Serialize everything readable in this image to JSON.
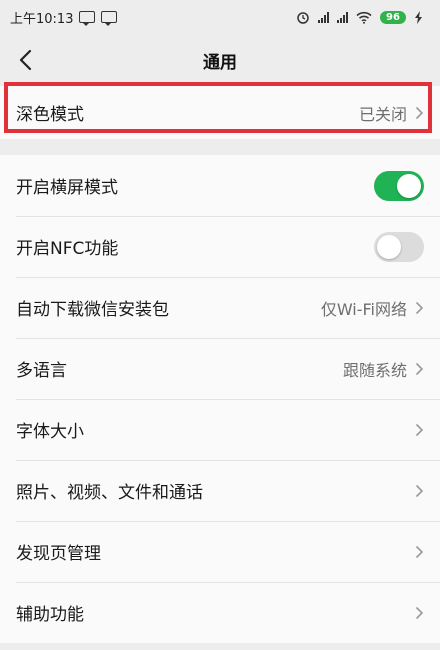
{
  "status_bar": {
    "time": "上午10:13",
    "battery": "96",
    "net_label": "HD"
  },
  "header": {
    "title": "通用"
  },
  "dark_mode": {
    "label": "深色模式",
    "value": "已关闭"
  },
  "settings": {
    "landscape": {
      "label": "开启横屏模式",
      "enabled": true
    },
    "nfc": {
      "label": "开启NFC功能",
      "enabled": false
    },
    "auto_download": {
      "label": "自动下载微信安装包",
      "value": "仅Wi-Fi网络"
    },
    "language": {
      "label": "多语言",
      "value": "跟随系统"
    },
    "font_size": {
      "label": "字体大小"
    },
    "media": {
      "label": "照片、视频、文件和通话"
    },
    "discover": {
      "label": "发现页管理"
    },
    "accessibility": {
      "label": "辅助功能"
    }
  },
  "colors": {
    "toggle_on": "#20b355",
    "toggle_off": "#dcdcdc",
    "highlight": "#e0323a",
    "background": "#ededed"
  }
}
